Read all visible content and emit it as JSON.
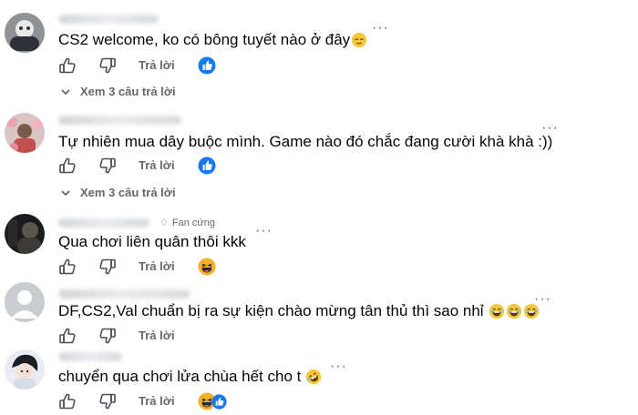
{
  "comments": [
    {
      "text": "CS2 welcome, ko có bông tuyết nào ở đây",
      "text_emojis": [
        "relieved-face"
      ],
      "badge": "",
      "reply_label": "Trả lời",
      "reaction": "like",
      "see_replies": "Xem 3 câu trả lời"
    },
    {
      "text": "Tự nhiên mua dây buộc mình. Game nào đó chắc đang cười khà khà :))",
      "text_emojis": [],
      "badge": "",
      "reply_label": "Trả lời",
      "reaction": "like",
      "see_replies": "Xem 3 câu trả lời"
    },
    {
      "text": "Qua chơi liên quân thôi kkk",
      "text_emojis": [],
      "badge": "Fan cứng",
      "reply_label": "Trả lời",
      "reaction": "haha",
      "see_replies": ""
    },
    {
      "text": "DF,CS2,Val chuẩn bị ra sự kiện chào mừng tân thủ thì sao nhỉ",
      "text_emojis": [
        "laughing-face",
        "laughing-face",
        "laughing-face"
      ],
      "badge": "",
      "reply_label": "Trả lời",
      "reaction": "",
      "see_replies": ""
    },
    {
      "text": "chuyển qua chơi lửa chùa hết cho t",
      "text_emojis": [
        "rolling-laughing-face"
      ],
      "badge": "",
      "reply_label": "Trả lời",
      "reaction": "haha+like",
      "see_replies": ""
    }
  ],
  "colors": {
    "secondary_text": "#65676b",
    "like_blue": "#1877f2",
    "haha_yellow": "#f7b125"
  }
}
